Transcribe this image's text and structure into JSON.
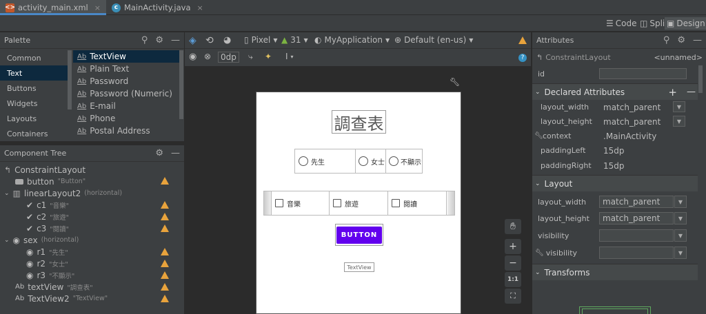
{
  "tabs": [
    {
      "label": "activity_main.xml",
      "active": true
    },
    {
      "label": "MainActivity.java",
      "active": false
    }
  ],
  "modes": {
    "code": "Code",
    "split": "Split",
    "design": "Design"
  },
  "palette": {
    "title": "Palette",
    "categories": [
      "Common",
      "Text",
      "Buttons",
      "Widgets",
      "Layouts",
      "Containers"
    ],
    "selected_category": "Text",
    "items": [
      "TextView",
      "Plain Text",
      "Password",
      "Password (Numeric)",
      "E-mail",
      "Phone",
      "Postal Address"
    ]
  },
  "tree": {
    "title": "Component Tree",
    "rows": [
      {
        "label": "ConstraintLayout",
        "sub": ""
      },
      {
        "label": "button",
        "sub": "\"Button\""
      },
      {
        "label": "linearLayout2",
        "sub": "(horizontal)"
      },
      {
        "label": "c1",
        "sub": "\"音樂\""
      },
      {
        "label": "c2",
        "sub": "\"旅遊\""
      },
      {
        "label": "c3",
        "sub": "\"閱讀\""
      },
      {
        "label": "sex",
        "sub": "(horizontal)"
      },
      {
        "label": "r1",
        "sub": "\"先生\""
      },
      {
        "label": "r2",
        "sub": "\"女士\""
      },
      {
        "label": "r3",
        "sub": "\"不顯示\""
      },
      {
        "label": "textView",
        "sub": "\"調查表\""
      },
      {
        "label": "TextView2",
        "sub": "\"TextView\""
      }
    ]
  },
  "design_toolbar": {
    "device": "Pixel",
    "api": "31",
    "app": "MyApplication",
    "locale": "Default (en-us)",
    "margin": "0dp"
  },
  "phone": {
    "title": "調查表",
    "radios": [
      "先生",
      "女士",
      "不顯示"
    ],
    "checks": [
      "音樂",
      "旅遊",
      "閱讀"
    ],
    "button": "BUTTON",
    "textview": "TextView"
  },
  "zoom": {
    "plus": "+",
    "minus": "−",
    "ratio": "1:1"
  },
  "attributes": {
    "title": "Attributes",
    "component": "ConstraintLayout",
    "name": "<unnamed>",
    "id_label": "id",
    "declared_title": "Declared Attributes",
    "declared": [
      {
        "key": "layout_width",
        "value": "match_parent"
      },
      {
        "key": "layout_height",
        "value": "match_parent"
      },
      {
        "key": "context",
        "value": ".MainActivity"
      },
      {
        "key": "paddingLeft",
        "value": "15dp"
      },
      {
        "key": "paddingRight",
        "value": "15dp"
      }
    ],
    "layout_title": "Layout",
    "layout": [
      {
        "key": "layout_width",
        "value": "match_parent"
      },
      {
        "key": "layout_height",
        "value": "match_parent"
      },
      {
        "key": "visibility",
        "value": ""
      },
      {
        "key": "visibility",
        "value": ""
      }
    ],
    "transforms_title": "Transforms"
  },
  "colors": {
    "accent": "#4a88c7",
    "button": "#6200ee",
    "warning": "#e8a33c",
    "selected": "#0d293e"
  }
}
